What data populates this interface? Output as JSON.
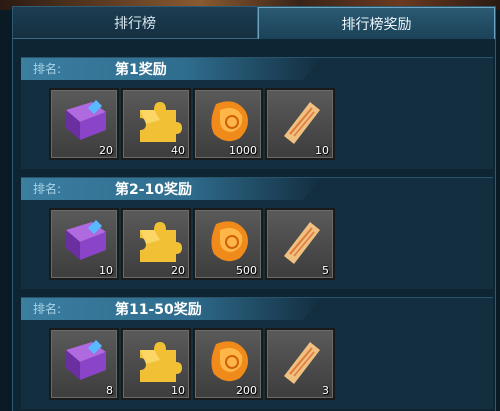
{
  "tabs": [
    "排行榜",
    "排行榜奖励"
  ],
  "rank_label": "排名:",
  "sections": [
    {
      "title": "第1奖励",
      "counts": [
        "20",
        "40",
        "1000",
        "10"
      ]
    },
    {
      "title": "第2-10奖励",
      "counts": [
        "10",
        "20",
        "500",
        "5"
      ]
    },
    {
      "title": "第11-50奖励",
      "counts": [
        "8",
        "10",
        "200",
        "3"
      ]
    }
  ],
  "items": [
    "purple-book-icon",
    "golden-puzzle-icon",
    "orange-shell-icon",
    "scroll-icon"
  ],
  "colors": {
    "tab_active": "#2a5a72",
    "panel": "#0e2533",
    "header_bar": "#3b7ea0"
  }
}
